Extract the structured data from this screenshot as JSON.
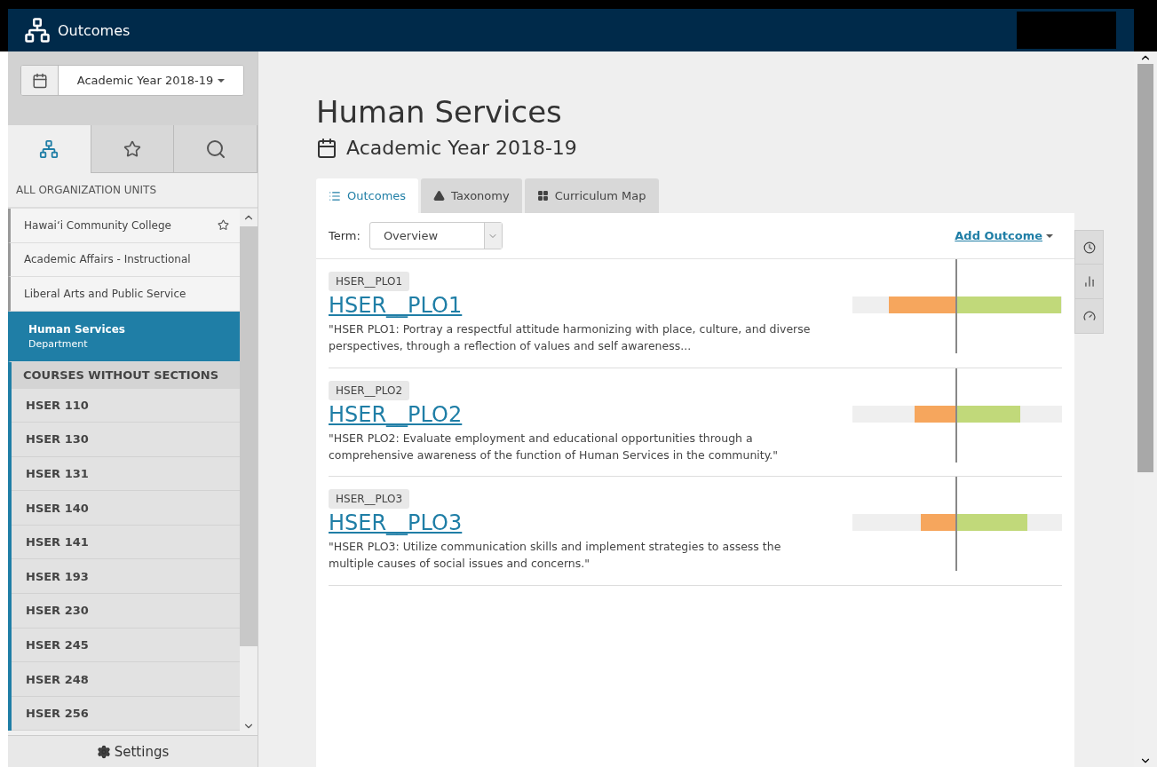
{
  "navbar": {
    "title": "Outcomes"
  },
  "sidebar": {
    "year_selector": "Academic Year 2018-19",
    "tabs": [
      {
        "kind": "tree",
        "selected": true
      },
      {
        "kind": "star",
        "selected": false
      },
      {
        "kind": "search",
        "selected": false
      }
    ],
    "section_label": "ALL ORGANIZATION UNITS",
    "org_units": [
      {
        "name": "Hawaiʻi Community College",
        "favorite": true,
        "selected": false
      },
      {
        "name": "Academic Affairs - Instructional",
        "favorite": false,
        "selected": false
      },
      {
        "name": "Liberal Arts and Public Service",
        "favorite": false,
        "selected": false
      },
      {
        "name": "Human Services",
        "subtitle": "Department",
        "favorite": false,
        "selected": true
      }
    ],
    "courses_header": "COURSES WITHOUT SECTIONS",
    "courses": [
      "HSER 110",
      "HSER 130",
      "HSER 131",
      "HSER 140",
      "HSER 141",
      "HSER 193",
      "HSER 230",
      "HSER 245",
      "HSER 248",
      "HSER 256"
    ],
    "settings": "Settings"
  },
  "main": {
    "title": "Human Services",
    "subtitle": "Academic Year 2018-19",
    "tabs": [
      {
        "kind": "list",
        "label": "Outcomes",
        "selected": true
      },
      {
        "kind": "pyramid",
        "label": "Taxonomy",
        "selected": false
      },
      {
        "kind": "grid",
        "label": "Curriculum Map",
        "selected": false
      }
    ],
    "term_label": "Term:",
    "term_value": "Overview",
    "add_outcome": "Add Outcome",
    "outcomes": [
      {
        "tag": "HSER__PLO1",
        "title": "HSER__PLO1",
        "description": "\"HSER PLO1: Portray a respectful attitude harmonizing with place, culture, and diverse perspectives, through a reflection of values and self awareness..."
      },
      {
        "tag": "HSER__PLO2",
        "title": "HSER__PLO2",
        "description": "\"HSER PLO2: Evaluate employment and educational opportunities through a comprehensive awareness of the function of Human Services in the community.\""
      },
      {
        "tag": "HSER__PLO3",
        "title": "HSER__PLO3",
        "description": "\"HSER PLO3: Utilize communication skills and implement strategies to assess the multiple causes of social issues and concerns.\""
      }
    ]
  }
}
